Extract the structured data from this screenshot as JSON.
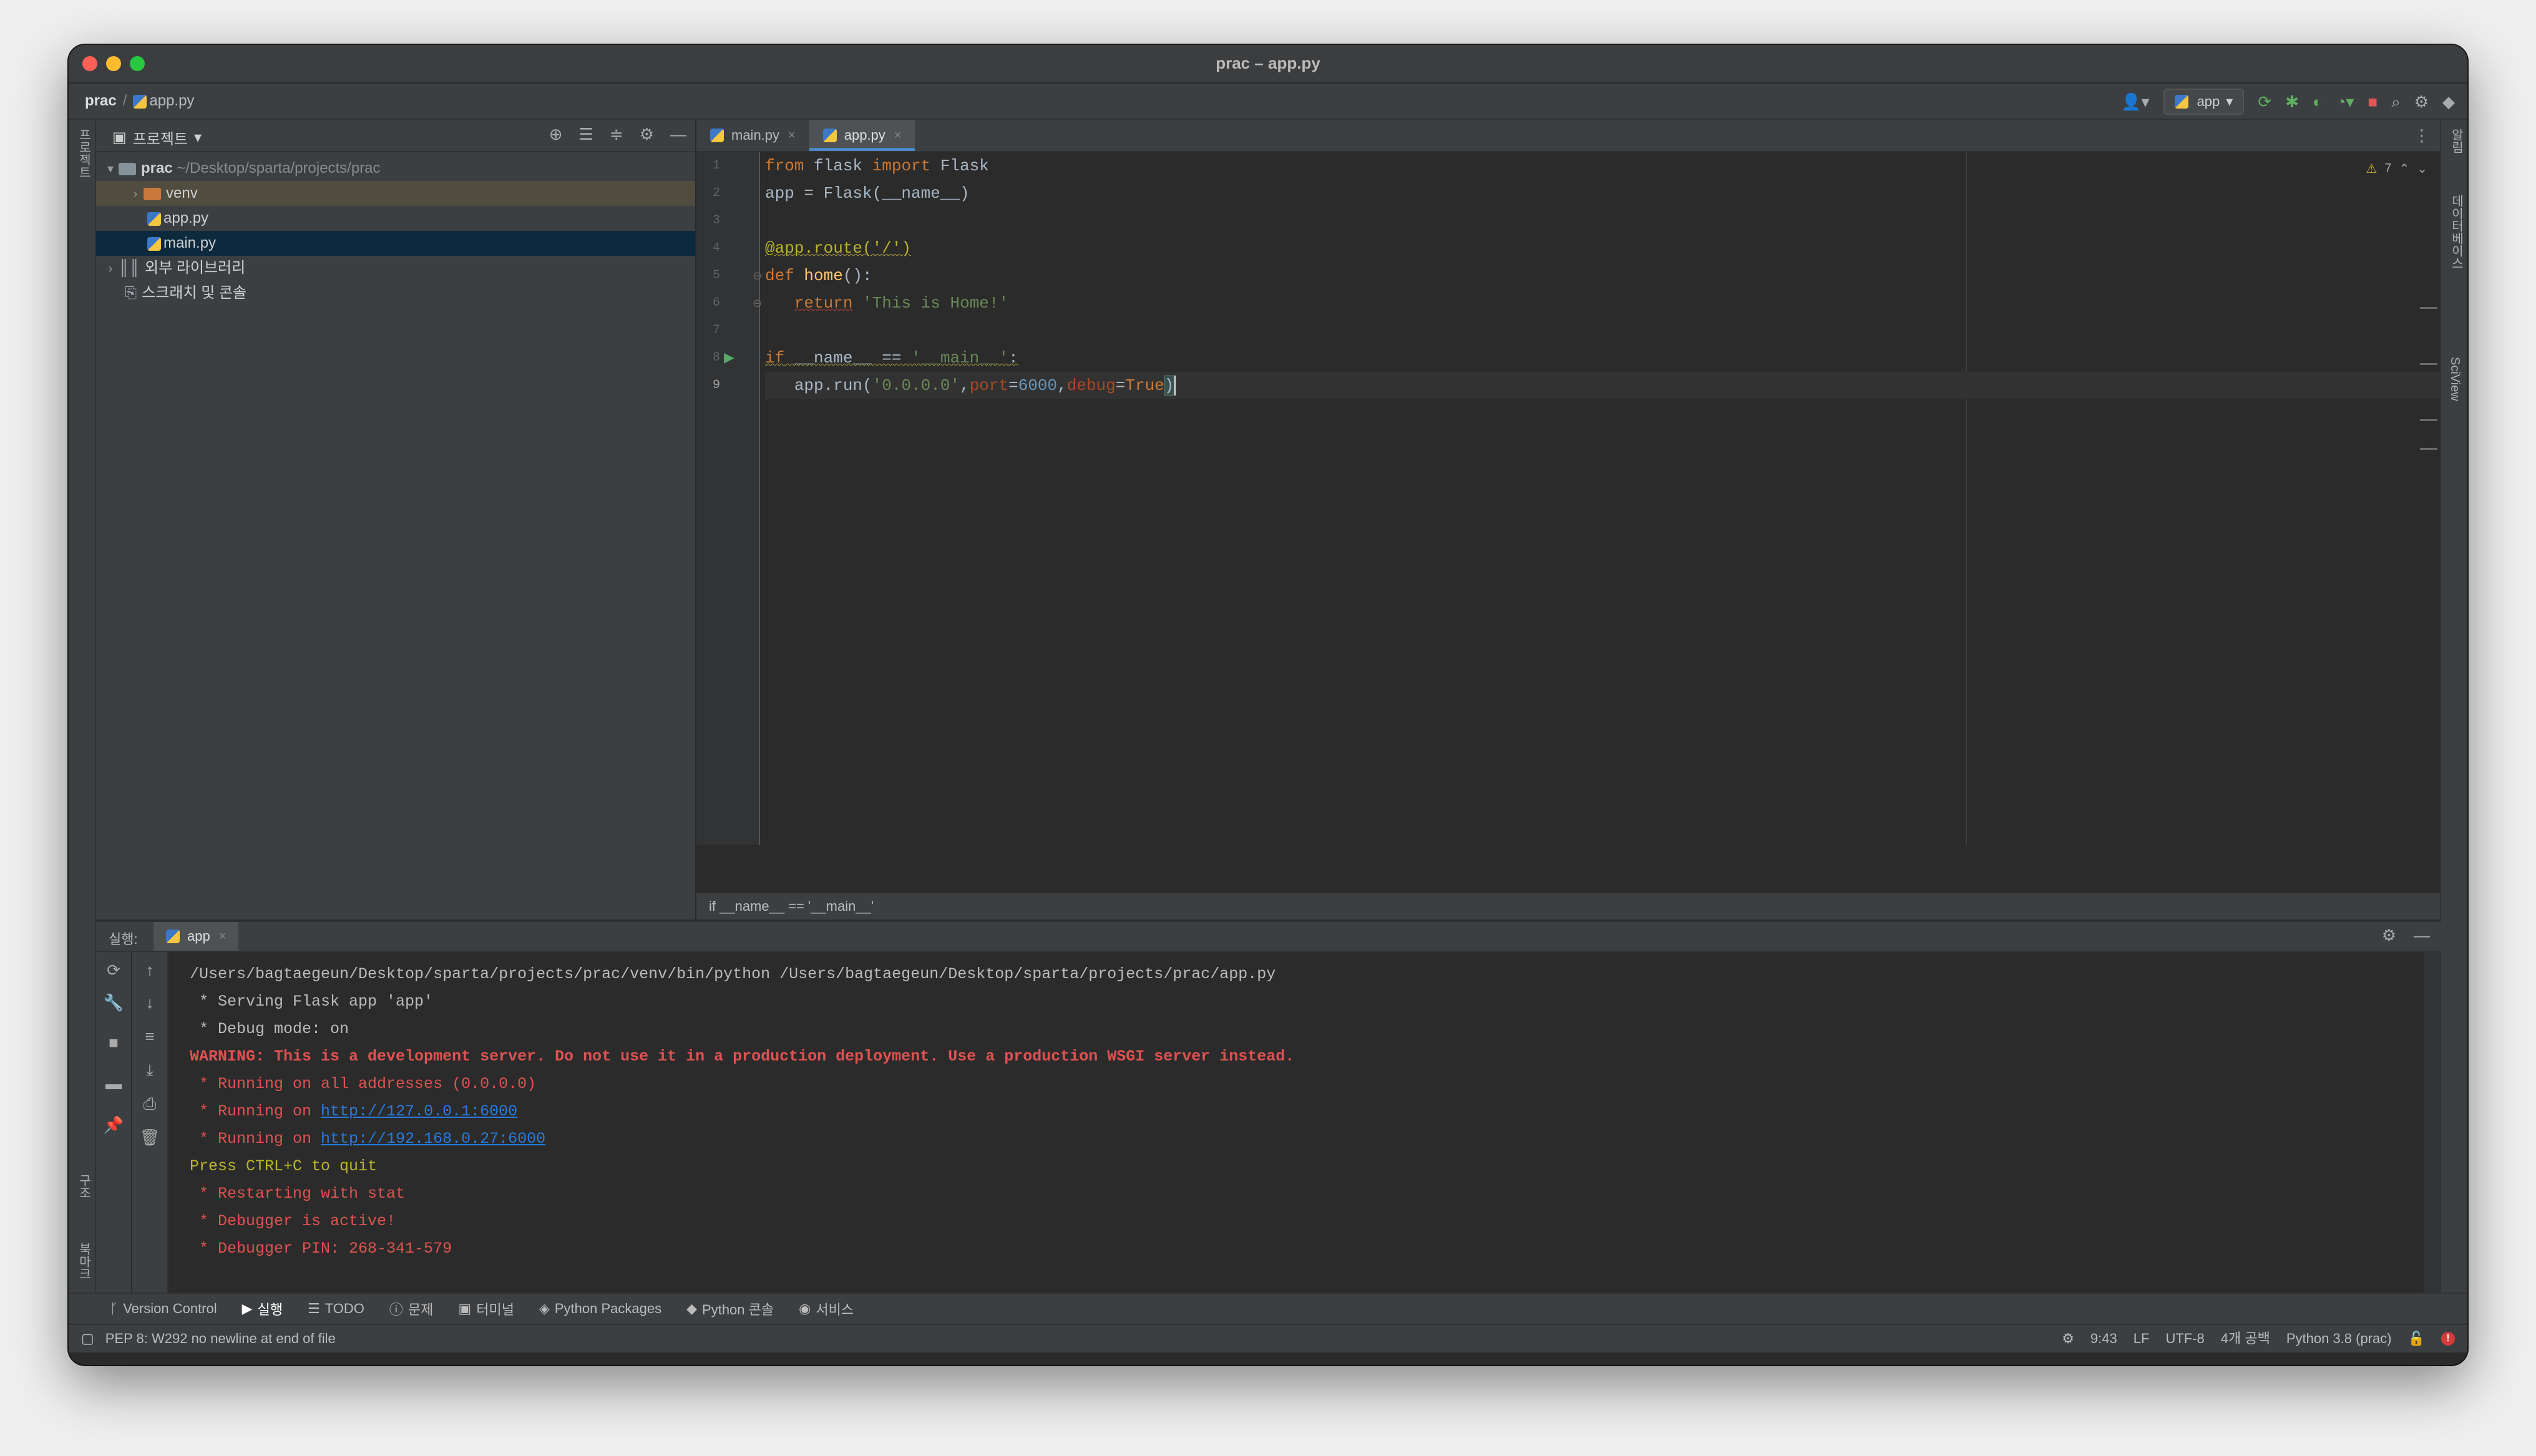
{
  "window": {
    "title": "prac – app.py"
  },
  "navbar": {
    "project": "prac",
    "file": "app.py",
    "run_config": "app"
  },
  "left_strip": {
    "top_label": "프로젝트",
    "bottom_label_1": "구조",
    "bottom_label_2": "북마크"
  },
  "right_strip": {
    "label_1": "알림",
    "label_2": "데이터베이스",
    "label_3": "SciView"
  },
  "project_panel": {
    "title": "프로젝트",
    "tree": {
      "root_name": "prac",
      "root_path": "~/Desktop/sparta/projects/prac",
      "venv": "venv",
      "file_app": "app.py",
      "file_main": "main.py",
      "ext_libs": "외부 라이브러리",
      "scratches": "스크래치 및 콘솔"
    }
  },
  "editor": {
    "tabs": [
      {
        "label": "main.py",
        "active": false
      },
      {
        "label": "app.py",
        "active": true
      }
    ],
    "line_numbers": [
      "1",
      "2",
      "3",
      "4",
      "5",
      "6",
      "7",
      "8",
      "9"
    ],
    "inspection_count": "7",
    "breadcrumb_footer": "if __name__ == '__main__'",
    "code": {
      "l1": {
        "kw1": "from",
        "mod": " flask ",
        "kw2": "import",
        "name": " Flask"
      },
      "l2": {
        "text": "app = Flask(__name__)"
      },
      "l4": {
        "deco": "@app.route('/')"
      },
      "l5": {
        "kw": "def",
        "fn": "home",
        "rest": "():"
      },
      "l6": {
        "kw": "return",
        "str": "'This is Home!'"
      },
      "l8": {
        "kw": "if",
        "mid": " __name__ == ",
        "str": "'__main__'",
        "end": ":"
      },
      "l9": {
        "obj": "app",
        "call": ".run(",
        "str": "'0.0.0.0'",
        "k1": "port",
        "v1": "6000",
        "k2": "debug",
        "v2": "True",
        "close": ")"
      }
    }
  },
  "run_panel": {
    "label": "실행:",
    "tab": "app",
    "output": {
      "cmd": "/Users/bagtaegeun/Desktop/sparta/projects/prac/venv/bin/python /Users/bagtaegeun/Desktop/sparta/projects/prac/app.py",
      "serving": " * Serving Flask app 'app'",
      "debug_mode": " * Debug mode: on",
      "warning": "WARNING: This is a development server. Do not use it in a production deployment. Use a production WSGI server instead.",
      "all_addr": " * Running on all addresses (0.0.0.0)",
      "run1_prefix": " * Running on ",
      "run1_link": "http://127.0.0.1:6000",
      "run2_prefix": " * Running on ",
      "run2_link": "http://192.168.0.27:6000",
      "quit": "Press CTRL+C to quit",
      "restart": " * Restarting with stat",
      "debugger": " * Debugger is active!",
      "pin": " * Debugger PIN: 268-341-579"
    }
  },
  "bottom_tabs": [
    {
      "label": "Version Control",
      "icon": "branch-icon"
    },
    {
      "label": "실행",
      "icon": "play-icon",
      "active": true
    },
    {
      "label": "TODO",
      "icon": "list-icon"
    },
    {
      "label": "문제",
      "icon": "info-icon"
    },
    {
      "label": "터미널",
      "icon": "terminal-icon"
    },
    {
      "label": "Python Packages",
      "icon": "layers-icon"
    },
    {
      "label": "Python 콘솔",
      "icon": "python-icon"
    },
    {
      "label": "서비스",
      "icon": "services-icon"
    }
  ],
  "statusbar": {
    "message": "PEP 8: W292 no newline at end of file",
    "position": "9:43",
    "line_sep": "LF",
    "encoding": "UTF-8",
    "indent": "4개 공백",
    "interpreter": "Python 3.8 (prac)"
  },
  "colors": {
    "background": "#2b2b2b",
    "panel": "#3c3f41",
    "accent": "#4a88c7",
    "error": "#e05252",
    "link": "#287bde"
  }
}
